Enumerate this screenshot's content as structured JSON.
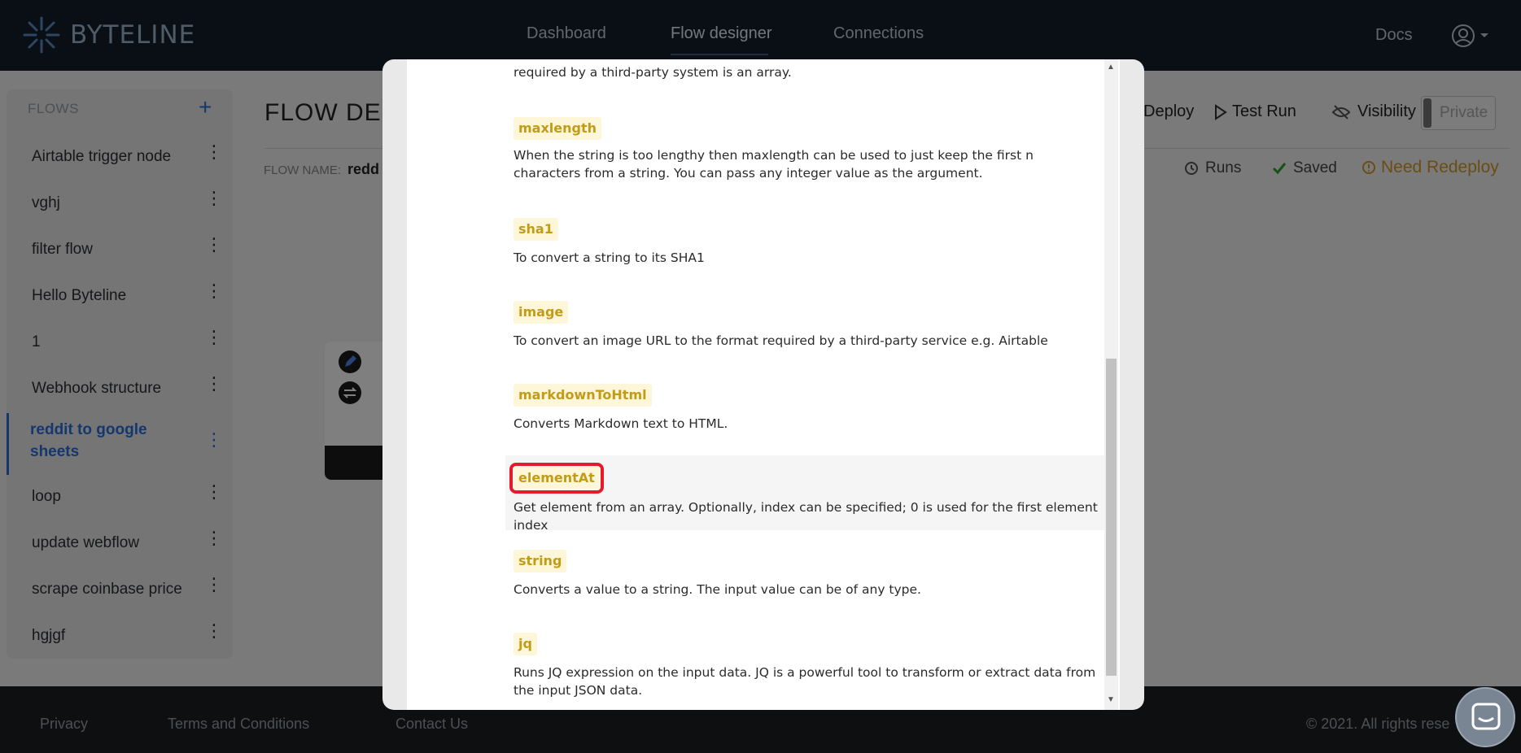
{
  "header": {
    "brand": "BYTELINE",
    "nav": [
      "Dashboard",
      "Flow designer",
      "Connections"
    ],
    "docs": "Docs",
    "user_icon": "user-circle-icon"
  },
  "sidebar": {
    "title": "FLOWS",
    "add_icon": "+",
    "items": [
      {
        "label": "Airtable trigger node"
      },
      {
        "label": "vghj"
      },
      {
        "label": "filter flow"
      },
      {
        "label": "Hello Byteline"
      },
      {
        "label": "1"
      },
      {
        "label": "Webhook structure"
      },
      {
        "label": "reddit to google sheets",
        "active": true
      },
      {
        "label": "loop"
      },
      {
        "label": "update webflow"
      },
      {
        "label": "scrape coinbase price"
      },
      {
        "label": "hgjgf"
      }
    ]
  },
  "main": {
    "title": "FLOW DES",
    "flow_name_label": "FLOW NAME:",
    "flow_name_value": "redd",
    "deploy": "Deploy",
    "test_run": "Test Run",
    "visibility": "Visibility",
    "private": "Private",
    "runs": "Runs",
    "saved": "Saved",
    "redeploy": "Need Redeploy"
  },
  "modal": {
    "top_partial": "required by a third-party system is an array.",
    "entries": [
      {
        "tag": "maxlength",
        "desc": "When the string is too lengthy then maxlength can be used to just keep the first n characters from a string. You can pass any integer value as the argument."
      },
      {
        "tag": "sha1",
        "desc": "To convert a string to its SHA1"
      },
      {
        "tag": "image",
        "desc": "To convert an image URL to the format required by a third-party service e.g. Airtable"
      },
      {
        "tag": "markdownToHtml",
        "desc": "Converts Markdown text to HTML."
      },
      {
        "tag": "elementAt",
        "desc": "Get element from an array. Optionally, index can be specified; 0 is used for the first element index",
        "highlighted": true
      },
      {
        "tag": "string",
        "desc": "Converts a value to a string. The input value can be of any type."
      },
      {
        "tag": "jq",
        "desc": "Runs JQ expression on the input data. JQ is a powerful tool to transform or extract data from the input JSON data."
      }
    ]
  },
  "footer": {
    "links": [
      "Privacy",
      "Terms and Conditions",
      "Contact Us"
    ],
    "copyright": "© 2021. All rights rese"
  }
}
